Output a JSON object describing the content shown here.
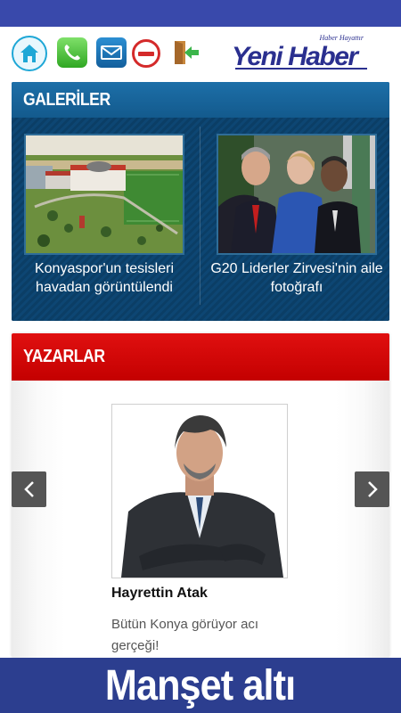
{
  "header": {
    "icons": [
      "home-icon",
      "phone-icon",
      "mail-icon",
      "block-icon",
      "exit-icon"
    ],
    "logo": {
      "text": "Yeni Haber",
      "tagline": "Haber Hayattır",
      "color": "#2a2f8f"
    }
  },
  "galeriler": {
    "title": "GALERİLER",
    "items": [
      {
        "caption": "Konyaspor'un tesisleri havadan görüntülendi"
      },
      {
        "caption": "G20 Liderler Zirvesi'nin aile fotoğrafı"
      }
    ]
  },
  "yazarlar": {
    "title": "YAZARLAR",
    "author": {
      "name": "Hayrettin Atak",
      "excerpt": "Bütün Konya görüyor acı gerçeği!"
    },
    "prev_icon": "chevron-left-icon",
    "next_icon": "chevron-right-icon"
  },
  "banner": {
    "text": "Manşet altı"
  },
  "colors": {
    "status_bar": "#3949ab",
    "galeriler_bg": "#0f4c7a",
    "yazarlar_header": "#d40000",
    "banner_bg": "#2c3e8f"
  }
}
